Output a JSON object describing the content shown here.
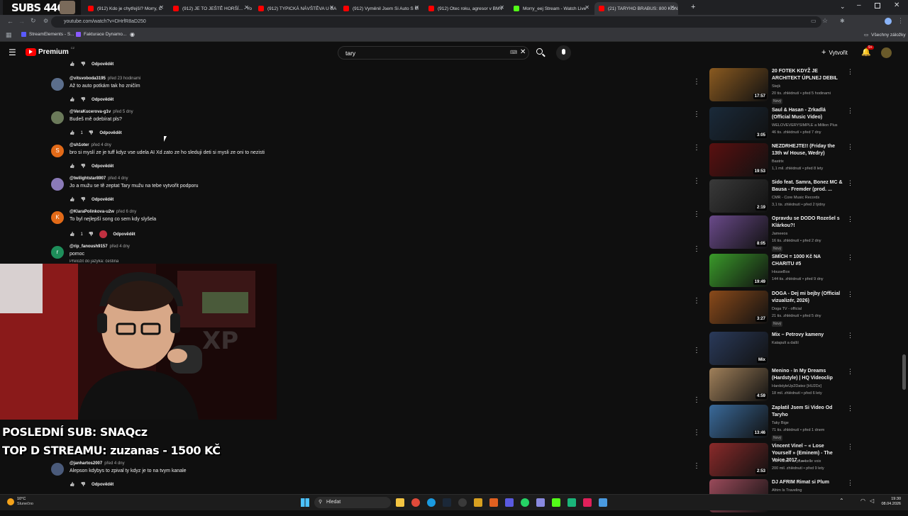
{
  "overlay": {
    "subs_counter": "SUBS 446",
    "last_sub": "POSLEDNÍ SUB: SNAQcz",
    "top_donor": "TOP D STREAMU: zuzanas - 1500 KČ"
  },
  "browser": {
    "tabs": [
      {
        "label": "(912) Kdo je chytřejší? Morry, C",
        "color": "#ff0000"
      },
      {
        "label": "(912) JE TO JEŠTĚ HORŠÍ... - Yo",
        "color": "#ff0000"
      },
      {
        "label": "(912) TYPICKÁ NÁVŠTĚVA U BA",
        "color": "#ff0000"
      },
      {
        "label": "(912) Vyměnil Jsem Si Auto S M",
        "color": "#ff0000"
      },
      {
        "label": "(912) Otec roku, agresor v BMV",
        "color": "#ff0000"
      },
      {
        "label": "Morry_eej Stream - Watch Live",
        "color": "#53fc18"
      },
      {
        "label": "(21) TARYHO BRABUS: 800 KON",
        "color": "#ff0000"
      }
    ],
    "url": "youtube.com/watch?v=DHrfR8aD250",
    "bookmarks": [
      "StreamElements - S...",
      "Fakturace Dynamo..."
    ],
    "all_bookmarks": "Všechny záložky"
  },
  "youtube": {
    "logo": "Premium",
    "logo_sup": "CZ",
    "search_value": "tary",
    "create_label": "Vytvořit",
    "notif_count": "9+"
  },
  "comments": [
    {
      "user": "",
      "time": "",
      "text": "",
      "likes": "",
      "reply": "Odpovědět",
      "av": "",
      "avcolor": ""
    },
    {
      "user": "@vitsvoboda3195",
      "time": "před 23 hodinami",
      "text": "Až to auto potkám tak ho zničím",
      "likes": "",
      "reply": "Odpovědět",
      "av": "",
      "avcolor": "#5b6e8c"
    },
    {
      "user": "@VeraKucerova-g1v",
      "time": "před 5 dny",
      "text": "Budeš mě odebírat pls?",
      "likes": "1",
      "reply": "Odpovědět",
      "av": "",
      "avcolor": "#6b7a5a"
    },
    {
      "user": "@sh1oter",
      "time": "před 4 dny",
      "text": "bro si myslí ze je tuff kdyz vse udela AI Xd zato ze ho sleduji deti si mysli ze oni to nezisti",
      "likes": "",
      "reply": "Odpovědět",
      "av": "S",
      "avcolor": "#e26a18"
    },
    {
      "user": "@twilightstar8907",
      "time": "před 4 dny",
      "text": "Jo a mužu se tě zeptat Tary mužu na tebe vytvořit podporu",
      "likes": "",
      "reply": "Odpovědět",
      "av": "",
      "avcolor": "#8a7ab8"
    },
    {
      "user": "@KlaraPolinkova-u2w",
      "time": "před 6 dny",
      "text": "To byl nejlepší song co sem kdy slyšela",
      "likes": "1",
      "reply": "Odpovědět",
      "av": "K",
      "avcolor": "#e26a18"
    },
    {
      "user": "@rip_fanoush9157",
      "time": "před 4 dny",
      "text": "pomoc",
      "likes": "",
      "reply": "",
      "av": "r",
      "avcolor": "#1e8e5a"
    },
    {
      "user": "@janhartos2007",
      "time": "před 4 dny",
      "text": "Alepson kdybys to zpival ty kdyz je to na tvym kanale",
      "likes": "",
      "reply": "Odpovědět",
      "av": "",
      "avcolor": "#4a5a7a"
    }
  ],
  "translate_hint": "Přeložit do jazyka: čeština",
  "sidebar": [
    {
      "title": "20 FOTEK KDYŽ JE ARCHITEKT ÚPLNEJ DEBIL",
      "channel": "Stejk",
      "meta": "20 tis. zhlédnutí • před 5 hodinami",
      "badge": "Nový",
      "dur": "17:57",
      "thumb": "#8a5a20"
    },
    {
      "title": "Saul & Hasan - Zrkadlá (Official Music Video)",
      "channel": "WELOVEVERYSIMPLE a Million Plus",
      "meta": "46 tis. zhlédnutí • před 7 dny",
      "badge": "",
      "dur": "3:05",
      "thumb": "#1a2a3a"
    },
    {
      "title": "NEZDRHEJTE!! (Friday the 13th w/ House, Wedry)",
      "channel": "Bastrix",
      "meta": "1,1 mil. zhlédnutí • před 8 lety",
      "badge": "",
      "dur": "19:53",
      "thumb": "#5a1010"
    },
    {
      "title": "Sido feat. Samra, Bonez MC & Bausa - Fremder (prod. ...",
      "channel": "CMR - Core Music Records",
      "meta": "3,1 tis. zhlédnutí • před 2 týdny",
      "badge": "",
      "dur": "2:19",
      "thumb": "#3a3a3a"
    },
    {
      "title": "Opravdu se DODO Rozešel s Klárkou?!",
      "channel": "Jameeos",
      "meta": "16 tis. zhlédnutí • před 2 dny",
      "badge": "Nový",
      "dur": "8:05",
      "thumb": "#6a4a8a"
    },
    {
      "title": "SMÍCH = 1000 Kč NA CHARITU #5",
      "channel": "HouseBox",
      "meta": "144 tis. zhlédnutí • před 9 dny",
      "badge": "",
      "dur": "19:49",
      "thumb": "#3a9a2a"
    },
    {
      "title": "DOGA - Dej mi bejby (Official vizualizér, 2026)",
      "channel": "Doga TV - official",
      "meta": "21 tis. zhlédnutí • před 5 dny",
      "badge": "Nový",
      "dur": "3:27",
      "thumb": "#8a4a1a"
    },
    {
      "title": "Mix – Petrovy kameny",
      "channel": "Katapult a další",
      "meta": "",
      "badge": "",
      "dur": "Mix",
      "thumb": "#2a3a5a"
    },
    {
      "title": "Menino - In My Dreams (Hardstyle) | HQ Videoclip",
      "channel": "HardstyleUp2Datez [HU2Dz]",
      "meta": "18 mil. zhlédnutí • před 6 lety",
      "badge": "",
      "dur": "4:59",
      "thumb": "#a0805a"
    },
    {
      "title": "Zaplatil Jsem Si Video Od Taryho",
      "channel": "Taky Bige",
      "meta": "71 tis. zhlédnutí • před 1 dnem",
      "badge": "Nový",
      "dur": "13:46",
      "thumb": "#3a6a9a"
    },
    {
      "title": "Vincent Vinel – « Lose Yourself » (Eminem) - The Voice 2017 - ...",
      "channel": "The Voice : la plus belle voix",
      "meta": "200 mil. zhlédnutí • před 9 lety",
      "badge": "",
      "dur": "2:53",
      "thumb": "#8a2a2a"
    },
    {
      "title": "DJ AFRIM Rimat si Plum",
      "channel": "Afrim Is Traveling",
      "meta": "",
      "badge": "",
      "dur": "",
      "thumb": "#9a4a5a"
    }
  ],
  "taskbar": {
    "weather_temp": "10°C",
    "weather_desc": "Slunečno",
    "search_placeholder": "Hledat",
    "time": "19:30",
    "date": "08.04.2026"
  }
}
